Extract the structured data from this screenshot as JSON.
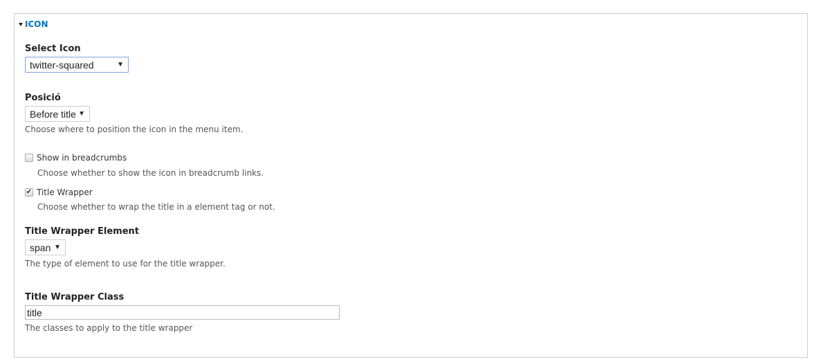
{
  "fieldset": {
    "legend": "ICON",
    "accent_color": "#0074bd"
  },
  "select_icon": {
    "label": "Select Icon",
    "value": "twitter-squared"
  },
  "position": {
    "label": "Posició",
    "value": "Before title",
    "description": "Choose where to position the icon in the menu item."
  },
  "show_breadcrumbs": {
    "label": "Show in breadcrumbs",
    "checked": false,
    "description": "Choose whether to show the icon in breadcrumb links."
  },
  "title_wrapper": {
    "label": "Title Wrapper",
    "checked": true,
    "description": "Choose whether to wrap the title in a element tag or not."
  },
  "title_wrapper_element": {
    "label": "Title Wrapper Element",
    "value": "span",
    "description": "The type of element to use for the title wrapper."
  },
  "title_wrapper_class": {
    "label": "Title Wrapper Class",
    "value": "title",
    "description": "The classes to apply to the title wrapper"
  },
  "icons": {
    "dropdown_arrow": "▼",
    "check": "✔"
  }
}
